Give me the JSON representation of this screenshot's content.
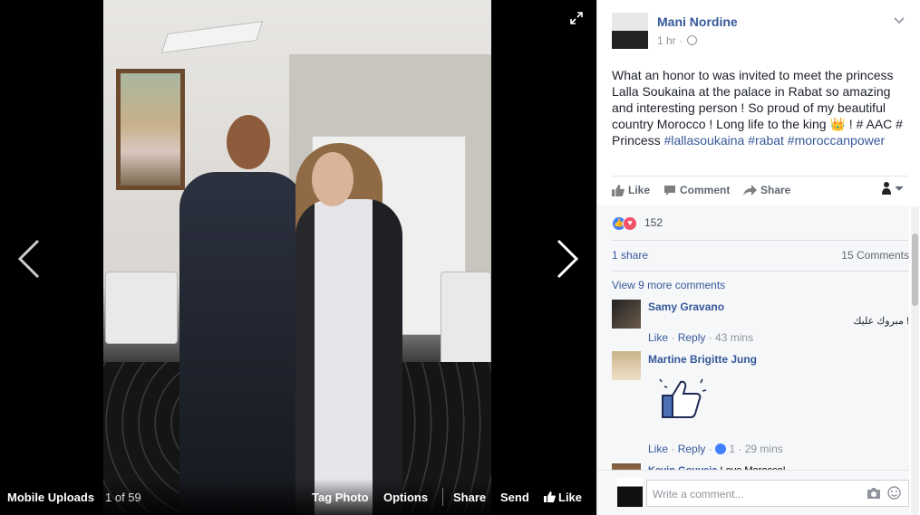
{
  "viewer": {
    "album_label": "Mobile Uploads",
    "counter": "1 of 59",
    "actions": {
      "tag_photo": "Tag Photo",
      "options": "Options",
      "share": "Share",
      "send": "Send",
      "like": "Like"
    }
  },
  "post": {
    "author": "Mani Nordine",
    "time": "1 hr ·",
    "text_1": "What an honor to was invited to meet the princess Lalla Soukaina at the palace in Rabat so amazing and interesting person ! So proud of my beautiful country Morocco ! Long life to the king ",
    "emoji": "👑",
    "text_2": " ! # AAC # Princess ",
    "hashtags": [
      "#lallasoukaina",
      "#rabat",
      "#moroccanpower"
    ],
    "actions": {
      "like": "Like",
      "comment": "Comment",
      "share": "Share"
    }
  },
  "reactions": {
    "count": "152",
    "shares": "1 share",
    "comments": "15 Comments",
    "view_more": "View 9 more comments"
  },
  "comments": [
    {
      "author": "Samy Gravano",
      "text": "مبروك عليك !",
      "like": "Like",
      "reply": "Reply",
      "time": "· 43 mins"
    },
    {
      "author": "Martine Brigitte Jung",
      "like": "Like",
      "reply": "Reply",
      "likes": "1",
      "time": "· 29 mins"
    },
    {
      "author": "Kevin Gouveia",
      "text": "Love Morocco!"
    }
  ],
  "composer": {
    "placeholder": "Write a comment..."
  },
  "colors": {
    "link": "#365899",
    "like_blue": "#4080ff",
    "love_red": "#f25268"
  }
}
